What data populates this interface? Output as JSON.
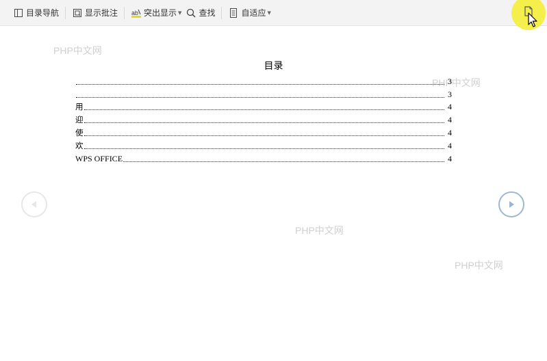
{
  "toolbar": {
    "toc_nav_label": "目录导航",
    "show_comments_label": "显示批注",
    "highlight_label": "突出显示",
    "find_label": "查找",
    "fit_label": "自适应"
  },
  "watermark": "PHP中文网",
  "toc": {
    "title": "目录",
    "rows": [
      {
        "label": "",
        "page": "3"
      },
      {
        "label": "",
        "page": "3"
      },
      {
        "label": "用",
        "page": "4"
      },
      {
        "label": "迎",
        "page": "4"
      },
      {
        "label": "使",
        "page": "4"
      },
      {
        "label": "欢",
        "page": "4"
      },
      {
        "label": "WPS OFFICE",
        "page": "4"
      }
    ]
  },
  "colors": {
    "toolbar_bg": "#f3f3f3",
    "highlight_circle": "#f4ef4a",
    "next_arrow": "#9fb6d3",
    "prev_arrow": "#e7e7e7"
  }
}
